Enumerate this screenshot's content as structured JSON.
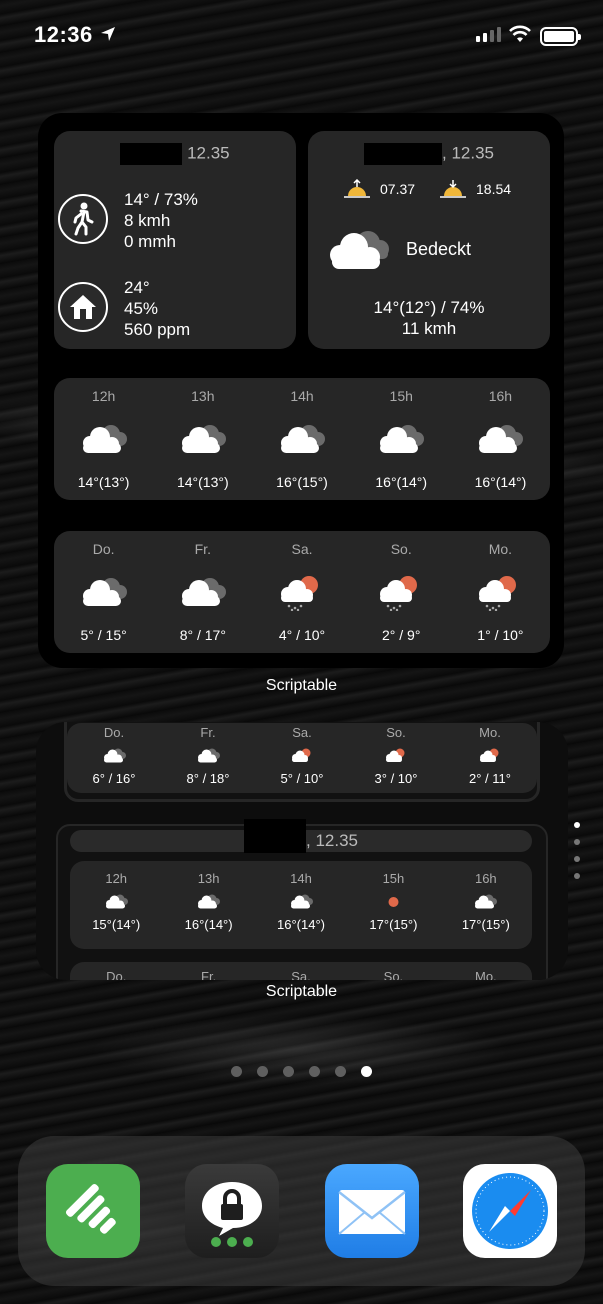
{
  "status_bar": {
    "time": "12:36"
  },
  "top_left_card": {
    "header_time": "12.35",
    "outdoor_lines": [
      "14° / 73%",
      "8 kmh",
      "0 mmh"
    ],
    "indoor_lines": [
      "24°",
      "45%",
      "560 ppm"
    ]
  },
  "top_right_card": {
    "header_time": ", 12.35",
    "sunrise": "07.37",
    "sunset": "18.54",
    "condition": "Bedeckt",
    "temp_line": "14°(12°) / 74%",
    "wind_line": "11 kmh"
  },
  "hourly": [
    {
      "label": "12h",
      "value": "14°(13°)",
      "icon": "cloud-icon"
    },
    {
      "label": "13h",
      "value": "14°(13°)",
      "icon": "cloud-icon"
    },
    {
      "label": "14h",
      "value": "16°(15°)",
      "icon": "cloud-icon"
    },
    {
      "label": "15h",
      "value": "16°(14°)",
      "icon": "cloud-icon"
    },
    {
      "label": "16h",
      "value": "16°(14°)",
      "icon": "cloud-icon"
    }
  ],
  "daily": [
    {
      "label": "Do.",
      "value": "5° / 15°",
      "icon": "cloud-icon"
    },
    {
      "label": "Fr.",
      "value": "8° / 17°",
      "icon": "cloud-icon"
    },
    {
      "label": "Sa.",
      "value": "4° / 10°",
      "icon": "sun-cloud-rain-icon"
    },
    {
      "label": "So.",
      "value": "2° / 9°",
      "icon": "sun-cloud-rain-icon"
    },
    {
      "label": "Mo.",
      "value": "1° / 10°",
      "icon": "sun-cloud-rain-icon"
    }
  ],
  "widget_label_1": "Scriptable",
  "stack": {
    "daily": [
      {
        "label": "Do.",
        "value": "6° / 16°",
        "icon": "cloud-icon"
      },
      {
        "label": "Fr.",
        "value": "8° / 18°",
        "icon": "cloud-icon"
      },
      {
        "label": "Sa.",
        "value": "5° / 10°",
        "icon": "sun-cloud-icon"
      },
      {
        "label": "So.",
        "value": "3° / 10°",
        "icon": "sun-cloud-icon"
      },
      {
        "label": "Mo.",
        "value": "2° / 11°",
        "icon": "sun-cloud-icon"
      }
    ],
    "header_time": ", 12.35",
    "hourly": [
      {
        "label": "12h",
        "value": "15°(14°)",
        "icon": "cloud-icon"
      },
      {
        "label": "13h",
        "value": "16°(14°)",
        "icon": "cloud-icon"
      },
      {
        "label": "14h",
        "value": "16°(14°)",
        "icon": "cloud-icon"
      },
      {
        "label": "15h",
        "value": "17°(15°)",
        "icon": "sun-icon"
      },
      {
        "label": "16h",
        "value": "17°(15°)",
        "icon": "cloud-icon"
      }
    ],
    "cut_labels": [
      "Do.",
      "Fr.",
      "Sa.",
      "So.",
      "Mo."
    ]
  },
  "widget_label_2": "Scriptable",
  "dock": {
    "apps": [
      "feedly-icon",
      "signal-lock-icon",
      "mail-icon",
      "safari-icon"
    ]
  },
  "colors": {
    "card": "#262626",
    "sun_orange": "#e0694a",
    "feedly_green": "#4cae4f",
    "mail_blue": "#2f8ff5"
  }
}
